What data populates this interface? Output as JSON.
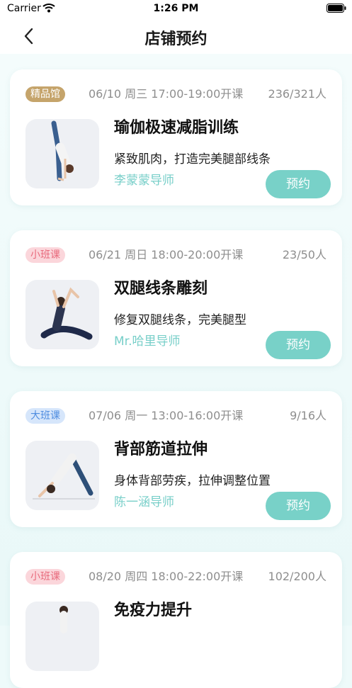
{
  "status_bar": {
    "carrier": "Carrier",
    "time": "1:26 PM",
    "wifi_icon": "wifi-icon",
    "battery_icon": "battery-icon"
  },
  "nav": {
    "title": "店铺预约",
    "back_icon": "chevron-left-icon"
  },
  "colors": {
    "accent": "#78d1c8",
    "teacher_text": "#78cfc9",
    "badge_gold": "#c5a46b",
    "badge_pink": "#fbd6db",
    "badge_blue": "#d6e6fb"
  },
  "courses": [
    {
      "badge": "精品馆",
      "schedule": "06/10 周三 17:00-19:00开课",
      "capacity": "236/321人",
      "title": "瑜伽极速减脂训练",
      "description": "紧致肌肉，打造完美腿部线条",
      "teacher": "李蒙蒙导师",
      "button": "预约"
    },
    {
      "badge": "小班课",
      "schedule": "06/21 周日 18:00-20:00开课",
      "capacity": "23/50人",
      "title": "双腿线条雕刻",
      "description": "修复双腿线条，完美腿型",
      "teacher": "Mr.哈里导师",
      "button": "预约"
    },
    {
      "badge": "大班课",
      "schedule": "07/06 周一 13:00-16:00开课",
      "capacity": "9/16人",
      "title": "背部筋道拉伸",
      "description": "身体背部劳疾，拉伸调整位置",
      "teacher": "陈一涵导师",
      "button": "预约"
    },
    {
      "badge": "小班课",
      "schedule": "08/20 周四 18:00-22:00开课",
      "capacity": "102/200人",
      "title": "免疫力提升",
      "description": "",
      "teacher": "",
      "button": ""
    }
  ]
}
